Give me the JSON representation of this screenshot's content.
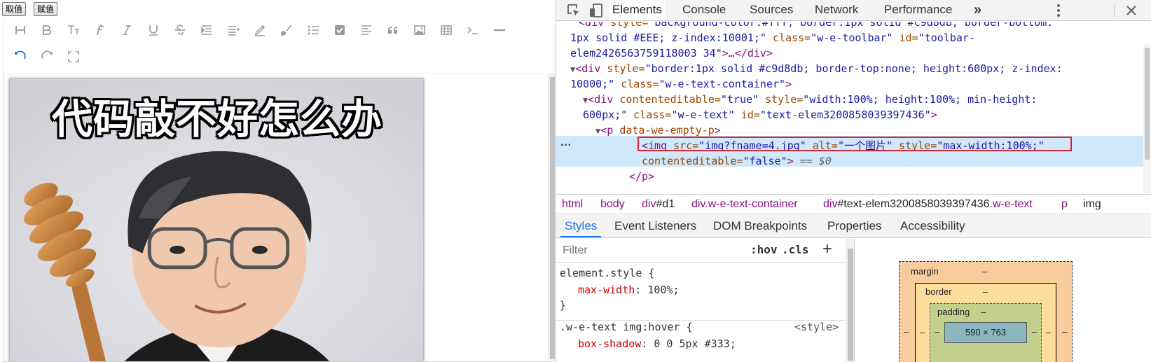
{
  "page": {
    "get_button": "取值",
    "set_button": "赋值",
    "meme_caption": "代码敲不好怎么办",
    "toolbar_icons": [
      "heading-icon",
      "bold-icon",
      "font-size-icon",
      "font-name-icon",
      "italic-icon",
      "underline-icon",
      "strikethrough-icon",
      "indent-icon",
      "line-height-icon",
      "fore-color-icon",
      "back-color-icon",
      "list-icon",
      "todo-icon",
      "justify-icon",
      "quote-icon",
      "image-icon",
      "table-icon",
      "code-icon",
      "divider-icon",
      "undo-icon",
      "redo-icon",
      "fullscreen-icon"
    ]
  },
  "devtools": {
    "tabs": [
      "Elements",
      "Console",
      "Sources",
      "Network",
      "Performance"
    ],
    "more_tabs": "»",
    "dom": {
      "line1": {
        "tag_open": "<div",
        "a1": " style=",
        "v1": "\"background-color:#fff; border:1px solid #c9d8db; border-bottom:"
      },
      "line2": {
        "v": "1px solid #EEE; z-index:10001;\"",
        "a": " class=",
        "v2": "\"w-e-toolbar\"",
        "a2": " id=",
        "v3": "\"toolbar-"
      },
      "line3": {
        "v": "elem2426563759118003 34\"",
        "tg": ">…</div>"
      },
      "line4": {
        "tg": "<div",
        "a": " style=",
        "v": "\"border:1px solid #c9d8db; border-top:none; height:600px; z-index:"
      },
      "line5": {
        "v": "10000;\"",
        "a": " class=",
        "v2": "\"w-e-text-container\"",
        "tg": ">"
      },
      "line6": {
        "tg": "<div",
        "a": " contenteditable=",
        "v": "\"true\"",
        "a2": " style=",
        "v2": "\"width:100%; height:100%; min-height:"
      },
      "line7": {
        "v": "600px;\"",
        "a": " class=",
        "v2": "\"w-e-text\"",
        "a2": " id=",
        "v3": "\"text-elem3200858039397436\"",
        "tg": ">"
      },
      "line8": {
        "tg": "<p",
        "a": " data-we-empty-p",
        "tg2": ">"
      },
      "line9": {
        "tg": "<img",
        "a": " src=",
        "q1": "\"",
        "link": "img?fname=4.jpg",
        "q2": "\"",
        "a2": " alt=",
        "v2": "\"一个图片\"",
        "a3": " style=",
        "v3": "\"max-width:100%;\""
      },
      "line10": {
        "a": "contenteditable=",
        "v": "\"false\"",
        "tg": ">",
        "eq": " == $0"
      },
      "line11": {
        "tg": "</p>"
      }
    },
    "breadcrumbs": [
      {
        "tag": "html",
        "rest": ""
      },
      {
        "tag": "body",
        "rest": ""
      },
      {
        "tag": "div",
        "rest": "#d1"
      },
      {
        "tag": "div",
        "rest": ".w-e-text-container"
      },
      {
        "tag": "div",
        "rest": "#text-elem3200858039397436",
        "cls": ".w-e-text"
      },
      {
        "tag": "p",
        "rest": ""
      },
      {
        "tag": "img",
        "rest": ""
      }
    ],
    "sub_tabs": [
      "Styles",
      "Event Listeners",
      "DOM Breakpoints",
      "Properties",
      "Accessibility"
    ],
    "filter_placeholder": "Filter",
    "hov": ":hov",
    "cls": ".cls",
    "plus": "+",
    "styles": {
      "element_style": "element.style {",
      "prop1_name": "max-width",
      "prop1_val": ": 100%;",
      "close": "}",
      "rule2_selector": ".w-e-text img:hover {",
      "rule2_source": "<style>",
      "rule2_prop": "box-shadow",
      "rule2_val": ": 0 0 5px #333;"
    },
    "box_model": {
      "margin_label": "margin",
      "margin_val": "–",
      "border_label": "border",
      "border_val": "–",
      "padding_label": "padding",
      "padding_val": "–",
      "content": "590 × 763",
      "dash": "–"
    }
  },
  "colors": {
    "selected_tab": "#1a73e8",
    "highlight": "#e0232e",
    "selection_bg": "#cfe8fc"
  }
}
